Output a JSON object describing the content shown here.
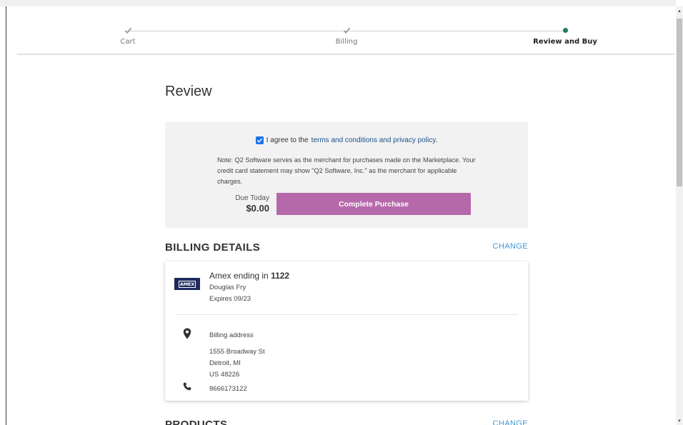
{
  "stepper": {
    "steps": [
      {
        "label": "Cart",
        "state": "done"
      },
      {
        "label": "Billing",
        "state": "done"
      },
      {
        "label": "Review and Buy",
        "state": "active"
      }
    ]
  },
  "page": {
    "title": "Review"
  },
  "agreement": {
    "checked": true,
    "text": "I agree to the",
    "link": "terms and conditions and privacy policy",
    "suffix": "."
  },
  "note": "Note: Q2 Software serves as the merchant for purchases made on the Marketplace. Your credit card statement may show \"Q2 Software, Inc.\" as the merchant for applicable charges.",
  "due": {
    "label": "Due Today",
    "amount": "$0.00"
  },
  "purchase_button": "Complete Purchase",
  "billing": {
    "heading": "BILLING DETAILS",
    "change": "CHANGE",
    "card_brand_logo": "AMEX",
    "card_title_prefix": "Amex ending in",
    "card_last4": "1122",
    "card_holder": "Douglas Fry",
    "expires": "Expires 09/23",
    "address_label": "Billing address",
    "address_line1": "1555 Broadway St",
    "address_line2": "Detroit, MI",
    "address_line3": "US 48226",
    "phone": "8666173122"
  },
  "products": {
    "heading": "PRODUCTS",
    "change": "CHANGE"
  },
  "colors": {
    "accent_button": "#b569aa",
    "link": "#3b9bd1",
    "active_step": "#1f7a62"
  },
  "icons": [
    "check-icon",
    "dot-icon",
    "checkbox-checked-icon",
    "amex-logo",
    "map-pin-icon",
    "phone-icon"
  ]
}
